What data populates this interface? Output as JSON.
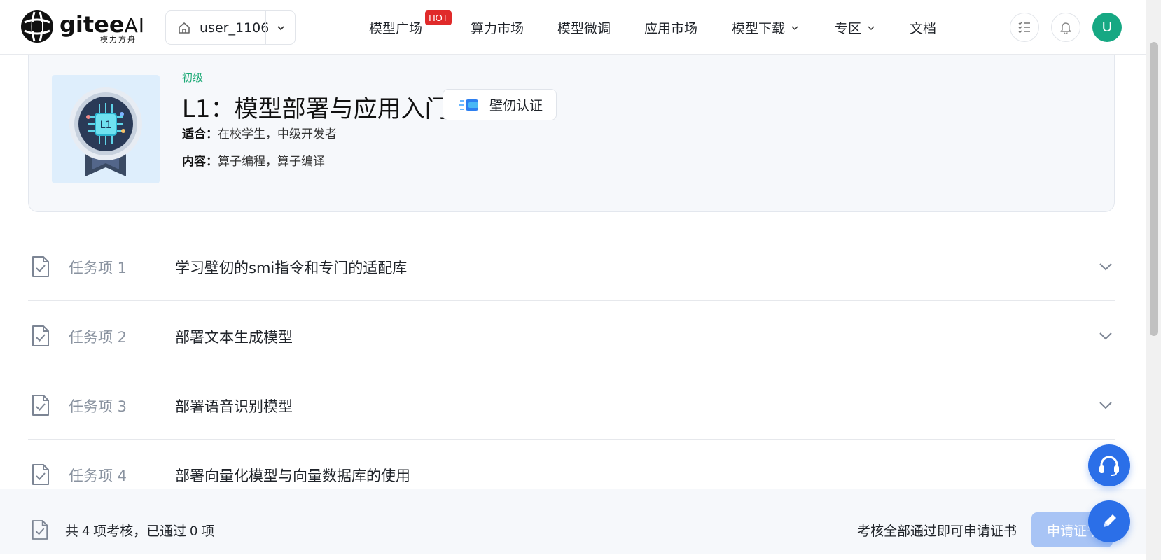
{
  "header": {
    "logo_main": "gitee",
    "logo_ai": "AI",
    "logo_sub": "模力方舟",
    "workspace_name": "user_1106",
    "nav": [
      {
        "label": "模型广场"
      },
      {
        "label": "算力市场"
      },
      {
        "label": "模型微调"
      },
      {
        "label": "应用市场"
      },
      {
        "label": "模型下载"
      },
      {
        "label": "专区"
      },
      {
        "label": "文档"
      }
    ],
    "hot_badge": "HOT",
    "avatar_initial": "U"
  },
  "course": {
    "level": "初级",
    "title": "L1：模型部署与应用入门",
    "cert_label": "壁仞认证",
    "audience_key": "适合：",
    "audience_value": "在校学生，中级开发者",
    "content_key": "内容：",
    "content_value": "算子编程，算子编译",
    "badge_text": "L1"
  },
  "tasks": [
    {
      "index": "任务项 1",
      "title": "学习壁仞的smi指令和专门的适配库"
    },
    {
      "index": "任务项 2",
      "title": "部署文本生成模型"
    },
    {
      "index": "任务项 3",
      "title": "部署语音识别模型"
    },
    {
      "index": "任务项 4",
      "title": "部署向量化模型与向量数据库的使用"
    }
  ],
  "footer": {
    "summary": "共 4 项考核，已通过 0 项",
    "note": "考核全部通过即可申请证书",
    "apply_label": "申请证书"
  },
  "colors": {
    "accent": "#2b6fe8",
    "level_green": "#19a974",
    "hot_red": "#e02a2a",
    "avatar_green": "#16a883"
  }
}
